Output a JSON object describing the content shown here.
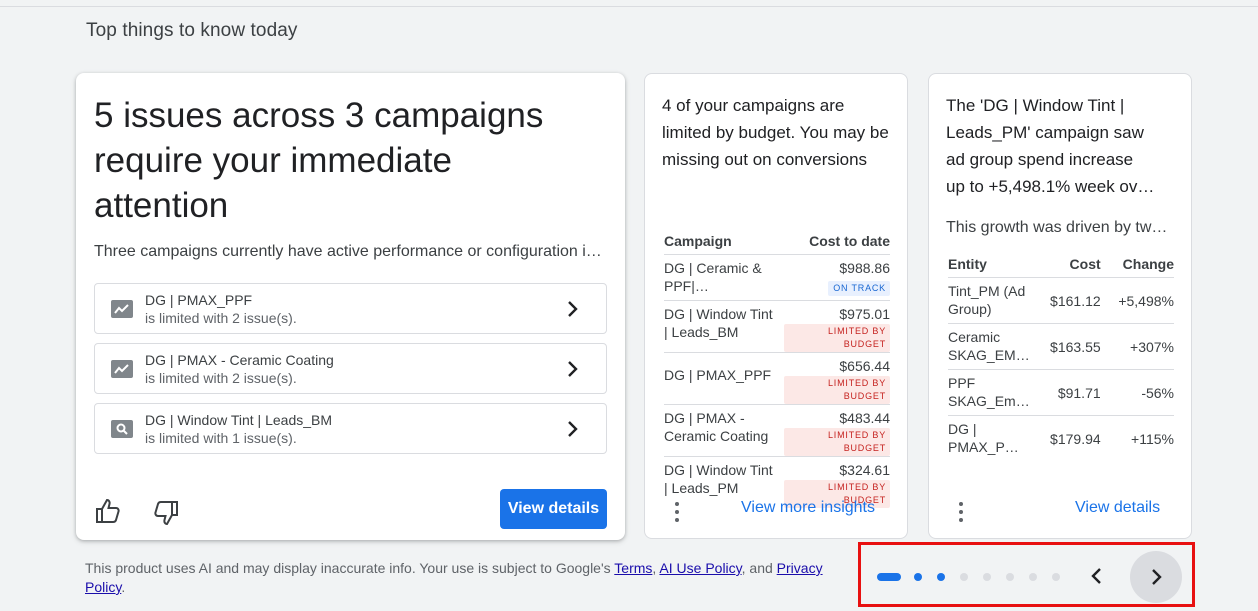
{
  "section_title": "Top things to know today",
  "card1": {
    "headline": "5 issues across 3 campaigns require your immediate attention",
    "summary": "Three campaigns currently have active performance or configuration issues",
    "issues": [
      {
        "name": "DG | PMAX_PPF",
        "detail": "is limited with 2 issue(s).",
        "icon": "performance-chart-icon"
      },
      {
        "name": "DG | PMAX - Ceramic Coating",
        "detail": "is limited with 2 issue(s).",
        "icon": "performance-chart-icon"
      },
      {
        "name": "DG | Window Tint | Leads_BM",
        "detail": "is limited with 1 issue(s).",
        "icon": "search-icon"
      }
    ],
    "view_details_label": "View details"
  },
  "card2": {
    "headline": "4 of your campaigns are limited by budget. You may be missing out on conversions",
    "columns": [
      "Campaign",
      "Cost to date"
    ],
    "rows": [
      {
        "campaign": "DG | Ceramic & PPF|…",
        "cost": "$988.86",
        "status": "ON TRACK"
      },
      {
        "campaign": "DG | Window Tint | Leads_BM",
        "cost": "$975.01",
        "status": "LIMITED BY BUDGET"
      },
      {
        "campaign": "DG | PMAX_PPF",
        "cost": "$656.44",
        "status": "LIMITED BY BUDGET"
      },
      {
        "campaign": "DG | PMAX - Ceramic Coating",
        "cost": "$483.44",
        "status": "LIMITED BY BUDGET"
      },
      {
        "campaign": "DG | Window Tint | Leads_PM",
        "cost": "$324.61",
        "status": "LIMITED BY BUDGET"
      }
    ],
    "link_label": "View more insights"
  },
  "card3": {
    "headline_lines": [
      "The 'DG | Window Tint |",
      "Leads_PM' campaign saw",
      "ad group spend increase",
      "up to +5,498.1% week ov…"
    ],
    "subtext": "This growth was driven by two ad groups",
    "columns": [
      "Entity",
      "Cost",
      "Change"
    ],
    "rows": [
      {
        "entity": "Tint_PM (Ad Group)",
        "cost": "$161.12",
        "change": "+5,498%"
      },
      {
        "entity": "Ceramic SKAG_EM…",
        "cost": "$163.55",
        "change": "+307%"
      },
      {
        "entity": "PPF SKAG_Em…",
        "cost": "$91.71",
        "change": "-56%"
      },
      {
        "entity": "DG | PMAX_P…",
        "cost": "$179.94",
        "change": "+115%"
      }
    ],
    "link_label": "View details"
  },
  "footer": {
    "text_before": "This product uses AI and may display inaccurate info. Your use is subject to Google's ",
    "terms": "Terms",
    "comma": ", ",
    "ai_policy": "AI Use Policy",
    "and": ", and ",
    "privacy": "Privacy Policy",
    "period": "."
  },
  "colors": {
    "accent": "#1a73e8",
    "highlight_border": "#e81010"
  }
}
